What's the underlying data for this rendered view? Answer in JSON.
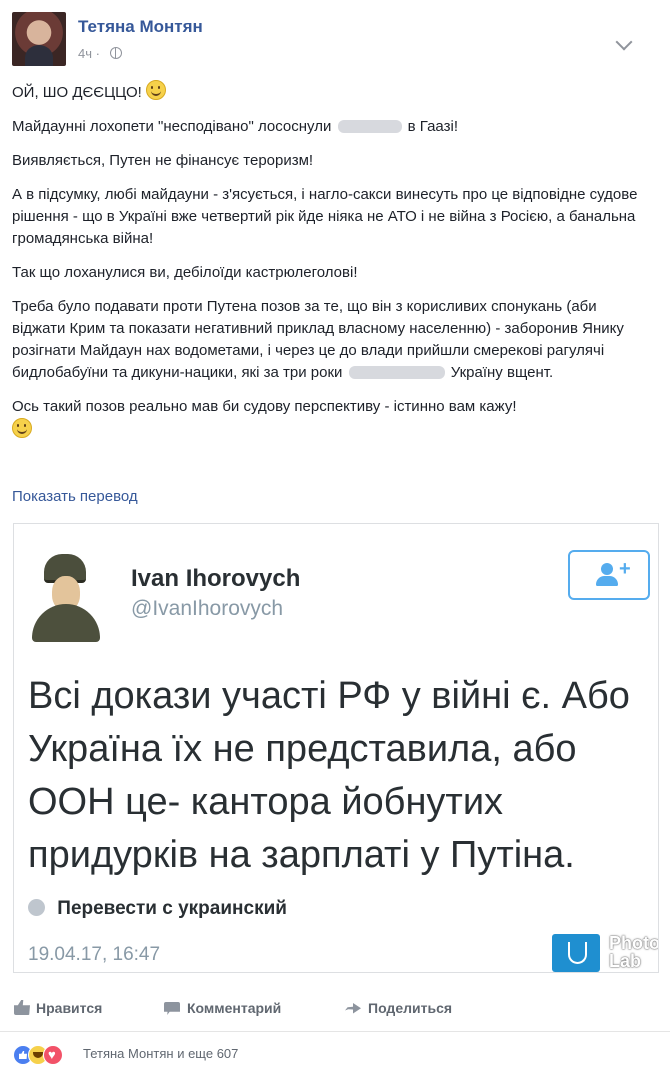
{
  "post": {
    "author": "Тетяна Монтян",
    "time": "4ч ·",
    "paragraphs": {
      "p1": "ОЙ, ШО ДЄЄЦЦО!",
      "p2_before": "Майдаунні лохопети \"несподівано\" лососнули",
      "p2_after": "в Гаазі!",
      "p3": "Виявляється, Путен не фінансує тероризм!",
      "p4": "А в підсумку, любі майдауни - з'ясується, і нагло-сакси винесуть про це відповідне судове рішення - що в Україні вже четвертий рік йде ніяка не АТО і не війна з Росією, а банальна громадянська війна!",
      "p5": "Так що лоханулися ви, дебілоїди кастрюлеголові!",
      "p6_before": "Треба було подавати проти Путена позов за те, що він з корисливих спонукань (аби віджати Крим та показати негативний приклад власному населенню) - заборонив Янику розігнати Майдаун нах водометами, і через це до влади прийшли смерекові рагулячі бидлобабуїни та дикуни-нацики, які за три роки",
      "p6_after": "Україну вщент.",
      "p7": "Ось такий позов реально мав би судову перспективу - істинно вам кажу!"
    },
    "translate_link": "Показать перевод"
  },
  "tweet": {
    "name": "Ivan Ihorovych",
    "handle": "@IvanIhorovych",
    "follow_plus": "+",
    "text": "Всі докази участі РФ у війні є. Або Україна їх не представила, або ООН це- кантора йобнутих придурків на зарплаті у Путіна.",
    "translate": "Перевести с украинский",
    "date": "19.04.17, 16:47",
    "watermark_1": "Photo",
    "watermark_2": "Lab"
  },
  "actions": {
    "like": "Нравится",
    "comment": "Комментарий",
    "share": "Поделиться"
  },
  "reactions": {
    "text": "Тетяна Монтян и еще 607"
  },
  "colors": {
    "link": "#365899",
    "muted": "#90949c",
    "twitter_blue": "#55acee"
  },
  "icons": [
    "globe-icon",
    "chevron-down-icon",
    "smile-emoji-icon",
    "follow-user-icon",
    "like-icon",
    "comment-icon",
    "share-icon",
    "reaction-like-icon",
    "reaction-haha-icon",
    "reaction-love-icon"
  ]
}
